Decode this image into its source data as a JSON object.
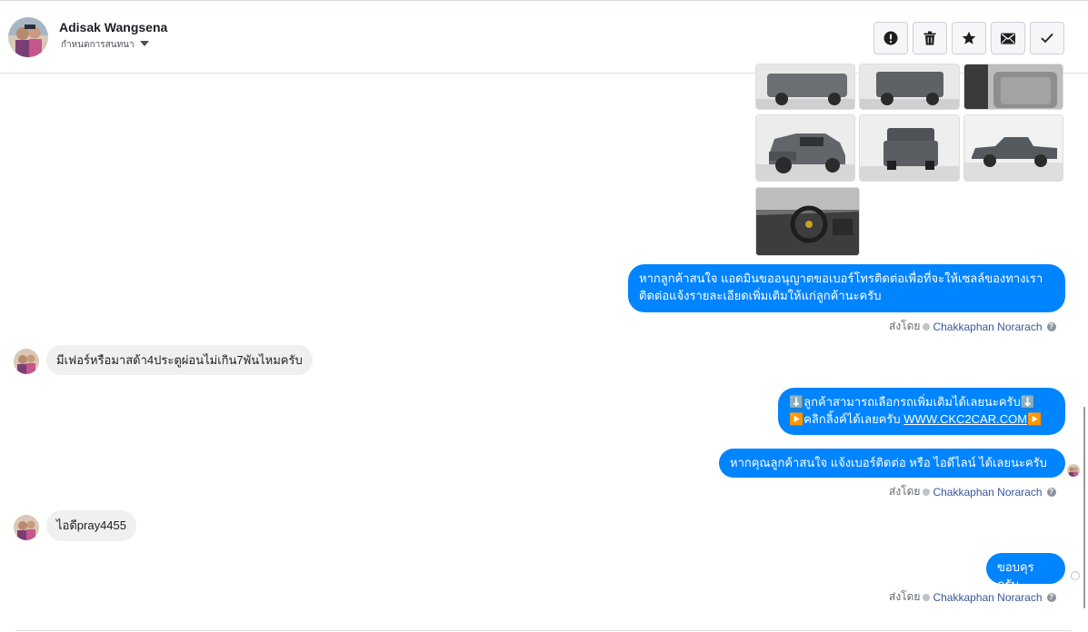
{
  "header": {
    "contact_name": "Adisak Wangsena",
    "contact_subtitle": "กำหนดการสนทนา",
    "actions": [
      {
        "name": "mark-spam",
        "icon": "alert-circle-icon"
      },
      {
        "name": "delete",
        "icon": "trash-icon"
      },
      {
        "name": "star",
        "icon": "star-icon"
      },
      {
        "name": "mark-unread",
        "icon": "envelope-icon"
      },
      {
        "name": "mark-done",
        "icon": "checkmark-icon"
      }
    ]
  },
  "messages": {
    "m1_text": "หากลูกค้าสนใจ แอดมินขออนุญาตขอเบอร์โทรติดต่อเพื่อที่จะให้เซลล์ของทางเราติดต่อแจ้งรายละเอียดเพิ่มเติมให้แก่ลูกค้านะครับ",
    "m2_text": "มีเฟอร์หรือมาสด้า4ประตูผ่อนไม่เกิน7พันไหมครับ",
    "m3_line1": "⬇️ลูกค้าสามารถเลือกรถเพิ่มเติมได้เลยนะครับ⬇️",
    "m3_line2_prefix": "▶️คลิกลิ้งค์ได้เลยครับ ",
    "m3_link": "WWW.CKC2CAR.COM",
    "m3_line2_suffix": "▶️",
    "m4_text": "หากคุณลูกค้าสนใจ แจ้งเบอร์ติดต่อ หรือ ไอดีไลน์ ได้เลยนะครับ",
    "m5_text": "ไอดีpray4455",
    "m6_text": "ขอบคุรครับ"
  },
  "sent_by": {
    "prefix": "ส่งโดย",
    "agent": "Chakkaphan Norarach",
    "help": "?"
  },
  "colors": {
    "outgoing_bubble": "#0084ff",
    "incoming_bubble": "#f1f0f0",
    "agent_link": "#385898"
  }
}
